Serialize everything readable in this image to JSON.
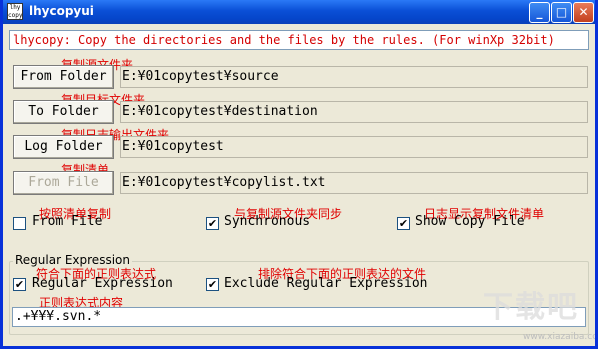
{
  "window": {
    "title": "lhycopyui",
    "icon_text": "lhy copy",
    "icon": "app-icon",
    "controls": {
      "minimize": "_",
      "maximize": "□",
      "close": "✕"
    }
  },
  "description": "lhycopy: Copy the directories and the files by the rules.  (For winXp 32bit)",
  "rows": [
    {
      "button": "From Folder",
      "path": "E:¥01copytest¥source",
      "note": "复制源文件夹",
      "enabled": true
    },
    {
      "button": "To Folder",
      "path": "E:¥01copytest¥destination",
      "note": "复制目标文件夹",
      "enabled": true
    },
    {
      "button": "Log Folder",
      "path": "E:¥01copytest",
      "note": "复制日志输出文件夹",
      "enabled": true
    },
    {
      "button": "From File",
      "path": "E:¥01copytest¥copylist.txt",
      "note": "复制清单",
      "enabled": false
    }
  ],
  "options": [
    {
      "label": "From File",
      "checked": false,
      "note": "按照清单复制"
    },
    {
      "label": "Synchronous",
      "checked": true,
      "note": "与复制源文件夹同步"
    },
    {
      "label": "Show Copy File",
      "checked": true,
      "note": "日志显示复制文件清单"
    }
  ],
  "regex_group": {
    "title": "Regular Expression",
    "options": [
      {
        "label": "Regular Expression",
        "checked": true,
        "note": "符合下面的正则表达式"
      },
      {
        "label": "Exclude Regular Expression",
        "checked": true,
        "note": "排除符合下面的正则表达的文件"
      }
    ],
    "input_note": "正则表达式内容",
    "input_value": ".+¥¥¥.svn.*"
  },
  "watermark": {
    "text": "下载吧",
    "sub": "www.xiazaiba.com"
  }
}
